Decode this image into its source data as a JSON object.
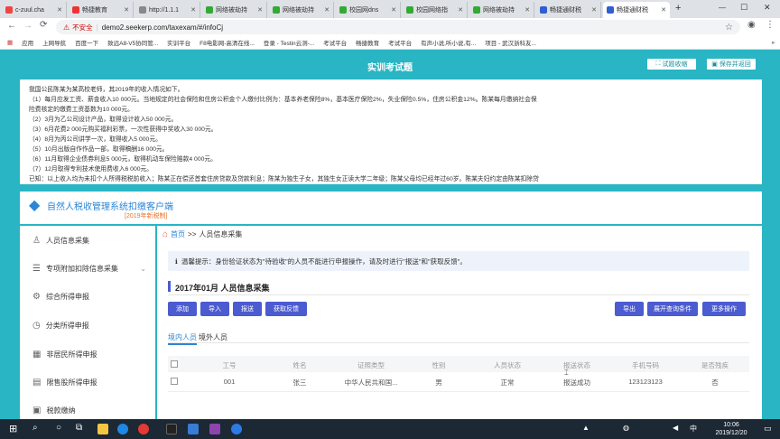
{
  "browser": {
    "tabs": [
      {
        "label": "c-zuul.cha",
        "color": "#e44"
      },
      {
        "label": "畅捷教育",
        "color": "#e33"
      },
      {
        "label": "http://1.1.1",
        "color": "#888"
      },
      {
        "label": "网络被劫持",
        "color": "#3a3"
      },
      {
        "label": "网络被劫持",
        "color": "#3a3"
      },
      {
        "label": "校园网dns",
        "color": "#3a3"
      },
      {
        "label": "校园网络指",
        "color": "#3a3"
      },
      {
        "label": "网络被劫持",
        "color": "#3a3"
      },
      {
        "label": "畅捷通财税",
        "color": "#2f5fd0"
      },
      {
        "label": "畅捷通财税",
        "color": "#2f5fd0"
      }
    ],
    "new_tab": "+",
    "insecure": "不安全",
    "url": "demo2.seekerp.com/taxexam/#/infoCj",
    "bookmarks": [
      "应用",
      "上网导航",
      "百度一下",
      "致远A8-V5协同管...",
      "实训平台",
      "F8电影网-高清在线...",
      "登录 - Testin云测-...",
      "考试平台",
      "畅捷教育",
      "考试平台",
      "有声小说,听小说,有...",
      "项目 - 武汉浙科友..."
    ]
  },
  "header": {
    "title": "实训考试题",
    "btn_collapse": "试题收缩",
    "btn_save": "保存并返回"
  },
  "question": {
    "lines": [
      "我国公民陈某为某高校老师，其2019年的收入情况如下。",
      "（1）每月应发工资、薪金收入10 000元。当地规定的社会保险和住房公积金个人缴付比例为：基本养老保险8%，基本医疗保险2%，失业保险0.5%，住房公积金12%。陈某每月缴纳社会保",
      "险费核定的缴费工资基数为10 000元。",
      "（2）3月为乙公司设计产品，取得设计收入50 000元。",
      "（3）6月花费2 000元购买福利彩票，一次性获得中奖收入30 000元。",
      "（4）8月为丙公司讲学一次，取得收入5 000元。",
      "（5）10月出版自作作品一部，取得稿酬16 000元。",
      "（6）11月取得企业债券利息5 000元，取得机动车保险赔款4 000元。",
      "（7）12月取得专利技术使用费收入6 000元。",
      "已知：以上收入均为未扣个人所得税税前收入；陈某正在偿还首套住房贷款及贷款利息；陈某为独生子女，其独生女正读大学二年级；陈某父母均已经年过60岁。陈某夫妇约定由陈某扣除贷"
    ]
  },
  "app": {
    "title": "自然人税收管理系统扣缴客户端",
    "subtitle": "[2019年新税制]"
  },
  "sidebar": {
    "items": [
      "人员信息采集",
      "专项附加扣除信息采集",
      "综合所得申报",
      "分类所得申报",
      "非居民所得申报",
      "限售股所得申报",
      "税款缴纳"
    ]
  },
  "main": {
    "breadcrumb_home": "首页",
    "breadcrumb_sep": ">>",
    "breadcrumb_current": "人员信息采集",
    "notice": "温馨提示：身份验证状态为\"待验收\"的人员不能进行申报操作，请及时进行\"报送\"和\"获取反馈\"。",
    "section_title": "2017年01月 人员信息采集",
    "buttons_left": [
      "添加",
      "导入",
      "报送",
      "获取反馈"
    ],
    "buttons_right": [
      "导出",
      "展开查询条件",
      "更多操作"
    ],
    "tabs": [
      "境内人员",
      "境外人员"
    ],
    "columns": [
      "工号",
      "姓名",
      "证照类型",
      "性别",
      "人员状态",
      "报送状态",
      "手机号码",
      "是否残疾"
    ],
    "rows": [
      [
        "001",
        "张三",
        "中华人民共和国...",
        "男",
        "正常",
        "报送成功",
        "123123123",
        "否"
      ]
    ]
  },
  "taskbar": {
    "time": "10:06",
    "date": "2019/12/20",
    "ime": "中"
  }
}
